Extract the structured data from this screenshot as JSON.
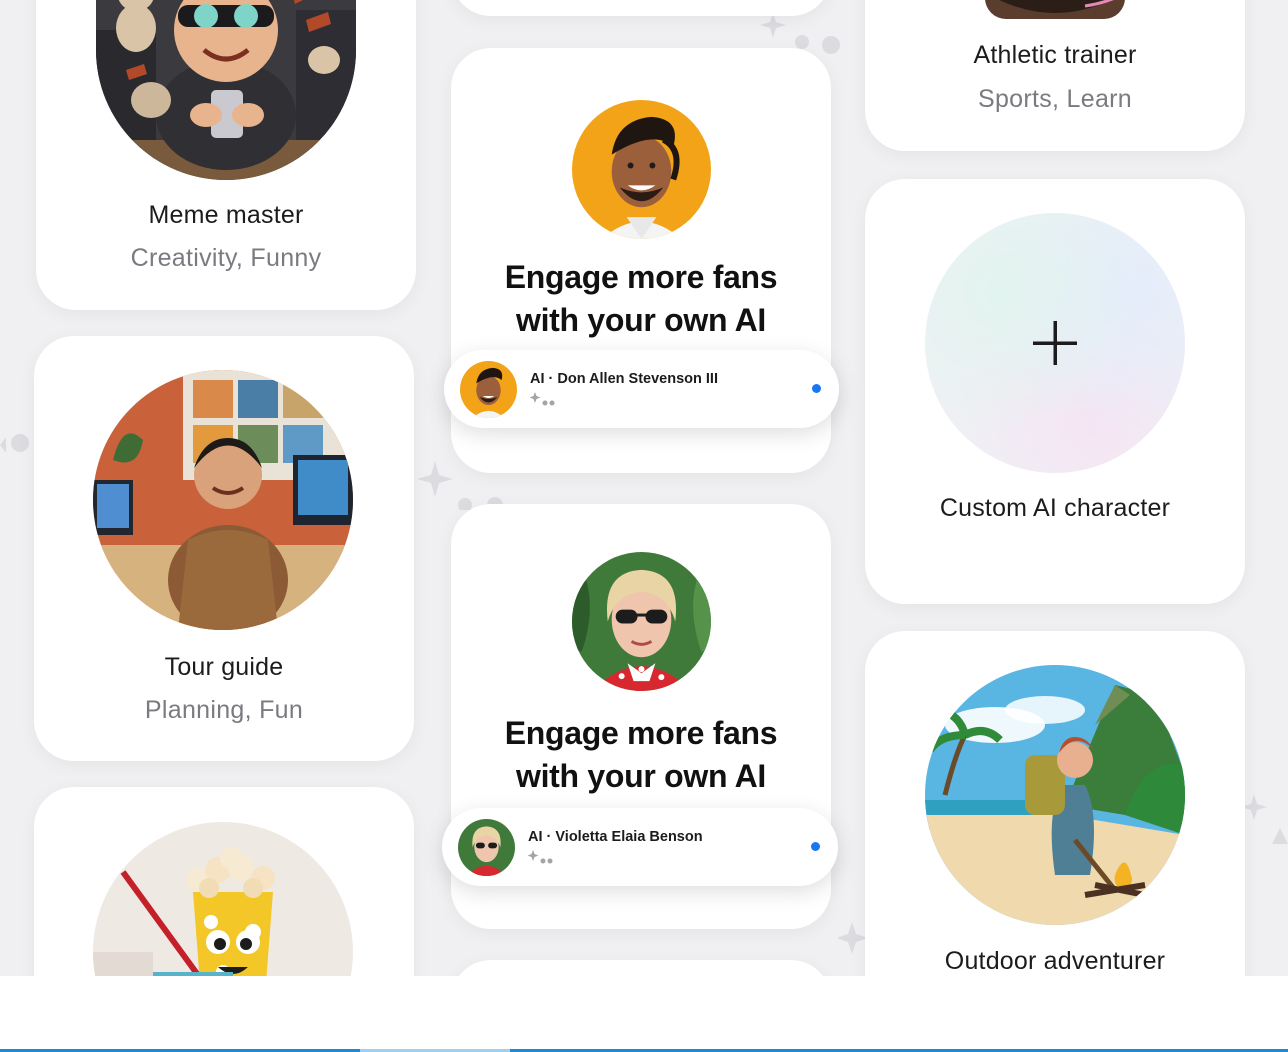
{
  "characters": {
    "meme_master": {
      "title": "Meme master",
      "subtitle": "Creativity, Funny"
    },
    "tour_guide": {
      "title": "Tour guide",
      "subtitle": "Planning, Fun"
    },
    "athletic_trainer": {
      "title": "Athletic trainer",
      "subtitle": "Sports, Learn"
    },
    "custom": {
      "title": "Custom AI character"
    },
    "outdoor": {
      "title": "Outdoor adventurer"
    }
  },
  "promos": [
    {
      "line1": "Engage more fans",
      "line2": "with your own AI",
      "chip": "AI · Don Allen Stevenson III"
    },
    {
      "line1": "Engage more fans",
      "line2": "with your own AI",
      "chip": "AI · Violetta Elaia Benson"
    }
  ],
  "icons": {
    "plus": "plus-icon",
    "sparkle": "sparkle-icon",
    "status": "online-dot-icon"
  },
  "colors": {
    "accent": "#1877f2",
    "background": "#f0f0f2",
    "card": "#ffffff",
    "footer_line": "#1d8ad6"
  }
}
